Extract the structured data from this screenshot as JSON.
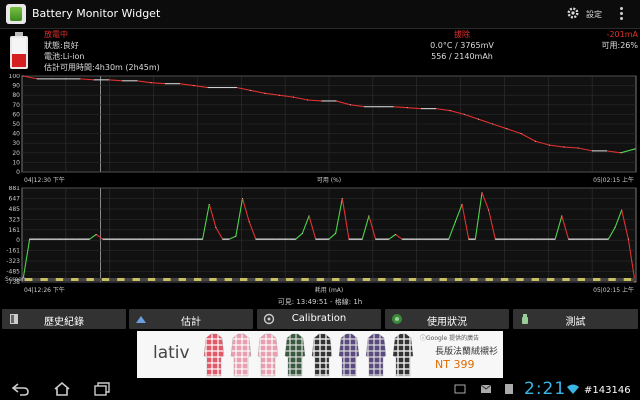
{
  "app": {
    "title": "Battery Monitor Widget",
    "settings_label": "設定"
  },
  "status": {
    "state": "放電中",
    "condition": "狀態:良好",
    "battery_type": "電池:Li-ion",
    "estimate": "估計可用時間:4h30m (2h45m)",
    "plug": "拔除",
    "temp_voltage": "0.0°C / 3765mV",
    "capacity": "556 / 2140mAh",
    "current": "-201mA",
    "available": "可用:26%"
  },
  "chart1": {
    "x_start": "04|12:30 下午",
    "x_label": "可用 (%)",
    "x_end": "05|02:15 上午",
    "y_ticks": [
      "100",
      "90",
      "80",
      "70",
      "60",
      "50",
      "40",
      "30",
      "20",
      "10",
      "0"
    ],
    "screen_label": ""
  },
  "chart2": {
    "x_start": "04|12:26 下午",
    "x_label": "耗用 (mA)",
    "x_end": "05|02:15 上午",
    "y_ticks": [
      "881",
      "647",
      "485",
      "323",
      "161",
      "0",
      "-161",
      "-323",
      "-485",
      "-738"
    ],
    "screen_label": "Screen"
  },
  "footer_info": "可見: 13:49:51 - 格線: 1h",
  "tabs": [
    {
      "label": "歷史紀錄",
      "icon": "history-icon"
    },
    {
      "label": "估計",
      "icon": "estimate-icon"
    },
    {
      "label": "Calibration",
      "icon": "calibration-icon"
    },
    {
      "label": "使用狀況",
      "icon": "usage-icon"
    },
    {
      "label": "測試",
      "icon": "test-icon"
    }
  ],
  "ad": {
    "brand": "lativ",
    "google_label": "ⓘGoogle 提供的廣告",
    "product": "長版法蘭絨襯衫",
    "price": "NT 399"
  },
  "navbar": {
    "clock": "2:21",
    "watermark": "#143146"
  },
  "chart_data": [
    {
      "type": "line",
      "title": "",
      "xlabel": "可用 (%)",
      "ylabel": "",
      "ylim": [
        0,
        100
      ],
      "x_range": [
        "04 12:30 下午",
        "05 02:15 上午"
      ],
      "series": [
        {
          "values": [
            100,
            97,
            97,
            97,
            97,
            96,
            96,
            95,
            95,
            93,
            92,
            92,
            90,
            88,
            88,
            88,
            85,
            82,
            80,
            78,
            75,
            74,
            74,
            70,
            68,
            68,
            68,
            67,
            66,
            66,
            64,
            60,
            55,
            50,
            45,
            40,
            32,
            28,
            26,
            25,
            22,
            22,
            20,
            24
          ]
        }
      ]
    },
    {
      "type": "line",
      "title": "",
      "xlabel": "耗用 (mA)",
      "ylabel": "",
      "ylim": [
        -738,
        881
      ],
      "x_range": [
        "04 12:26 下午",
        "05 02:15 上午"
      ],
      "series": [
        {
          "values": [
            -700,
            0,
            0,
            0,
            0,
            0,
            0,
            0,
            0,
            0,
            0,
            80,
            0,
            0,
            0,
            0,
            0,
            0,
            0,
            0,
            0,
            0,
            0,
            0,
            0,
            0,
            0,
            0,
            600,
            200,
            0,
            0,
            50,
            700,
            300,
            0,
            0,
            0,
            0,
            0,
            0,
            0,
            100,
            400,
            0,
            0,
            0,
            100,
            700,
            0,
            0,
            0,
            400,
            0,
            0,
            0,
            80,
            0,
            0,
            0,
            0,
            0,
            0,
            0,
            0,
            300,
            600,
            0,
            0,
            800,
            500,
            0,
            0,
            0,
            0,
            0,
            0,
            0,
            0,
            0,
            0,
            400,
            0,
            0,
            0,
            0,
            0,
            0,
            0,
            200,
            500,
            0,
            -738
          ]
        }
      ]
    }
  ]
}
